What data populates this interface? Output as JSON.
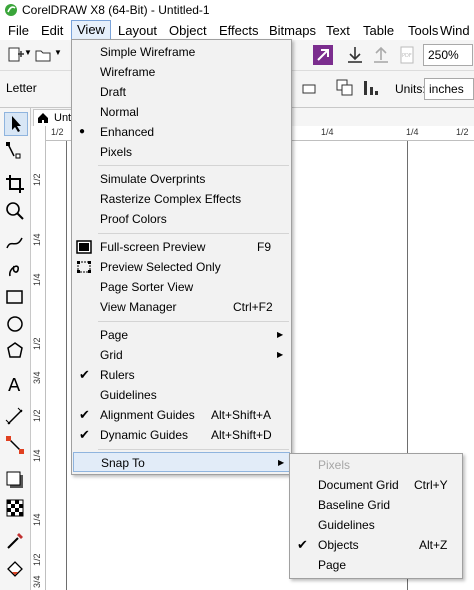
{
  "window": {
    "title": "CorelDRAW X8 (64-Bit) - Untitled-1"
  },
  "menubar": {
    "items": [
      "File",
      "Edit",
      "View",
      "Layout",
      "Object",
      "Effects",
      "Bitmaps",
      "Text",
      "Table",
      "Tools",
      "Wind"
    ],
    "active": "View"
  },
  "toolbar": {
    "zoom": "250%",
    "page_size": "Letter",
    "units_label": "Units:",
    "units_value": "inches"
  },
  "document": {
    "tab_label": "Unti"
  },
  "rulers": {
    "h_labels": [
      "1/2",
      "1/4",
      "1/4",
      "1/2"
    ],
    "v_labels": [
      "1/2",
      "1/4",
      "1/4",
      "1/2",
      "3/4",
      "1/2",
      "1/4",
      "1/4",
      "1/2",
      "3/4"
    ]
  },
  "view_menu": {
    "items": [
      {
        "label": "Simple Wireframe"
      },
      {
        "label": "Wireframe"
      },
      {
        "label": "Draft"
      },
      {
        "label": "Normal"
      },
      {
        "label": "Enhanced",
        "marker": "●"
      },
      {
        "label": "Pixels"
      },
      {
        "label": "Simulate Overprints"
      },
      {
        "label": "Rasterize Complex Effects"
      },
      {
        "label": "Proof Colors"
      },
      {
        "label": "Full-screen Preview",
        "shortcut": "F9"
      },
      {
        "label": "Preview Selected Only"
      },
      {
        "label": "Page Sorter View"
      },
      {
        "label": "View Manager",
        "shortcut": "Ctrl+F2"
      },
      {
        "label": "Page"
      },
      {
        "label": "Grid"
      },
      {
        "label": "Rulers",
        "marker": "✔"
      },
      {
        "label": "Guidelines"
      },
      {
        "label": "Alignment Guides",
        "marker": "✔",
        "shortcut": "Alt+Shift+A"
      },
      {
        "label": "Dynamic Guides",
        "marker": "✔",
        "shortcut": "Alt+Shift+D"
      },
      {
        "label": "Snap To"
      }
    ]
  },
  "snap_menu": {
    "items": [
      {
        "label": "Pixels"
      },
      {
        "label": "Document Grid",
        "shortcut": "Ctrl+Y"
      },
      {
        "label": "Baseline Grid"
      },
      {
        "label": "Guidelines"
      },
      {
        "label": "Objects",
        "marker": "✔",
        "shortcut": "Alt+Z"
      },
      {
        "label": "Page"
      }
    ]
  },
  "colors": {
    "menu_bg": "#f2f2f2",
    "highlight": "#e2ecf8",
    "highlight_border": "#8fb4de",
    "accent_purple": "#7b2d8e",
    "coral_green": "#3aa53a"
  }
}
